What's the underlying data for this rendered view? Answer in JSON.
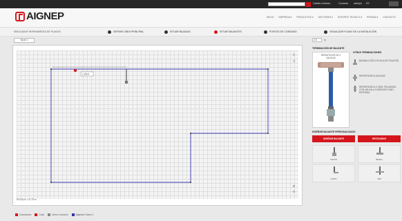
{
  "topbar": {
    "search_placeholder": "",
    "links": [
      "Calidad centrada",
      "Contactar",
      "aba/spa",
      "ES"
    ]
  },
  "header": {
    "logo_text": "AIGNEP",
    "nav": [
      "INICIO",
      "EMPRESA ▾",
      "PRODUCTOS ▾",
      "SECTORES ▾",
      "SOPORTE TÉCNICO ▾",
      "PRENSA ▾",
      "CONTACTO"
    ]
  },
  "steps_bar": {
    "title": "SIMULADOR HERRAMIENTA DE PLANOS",
    "steps": [
      {
        "label": "DEFINIR LÍNEA PRINCIPAL",
        "active": false
      },
      {
        "label": "SITUAR BAJADAS",
        "active": false
      },
      {
        "label": "SITUAR BAJANTES",
        "active": true
      },
      {
        "label": "PUNTOS DE CONSUMO",
        "active": false
      },
      {
        "label": "VISUALIZAR PLANO DE LA INSTALACIÓN",
        "active": false
      }
    ]
  },
  "tabs": [
    "Nivel 1"
  ],
  "canvas": {
    "scale_label": "ESCALA: 1:0.75 m",
    "dimension_label": "1.25 m"
  },
  "legend": [
    {
      "label": "Conexiones",
      "color": "#d4161c"
    },
    {
      "label": "Codo",
      "color": "#d4161c"
    },
    {
      "label": "Unión Conexión",
      "color": "#888888"
    },
    {
      "label": "Bajantes Tramo 1",
      "color": "#3333aa"
    }
  ],
  "right": {
    "unit_value": "2.5",
    "unit_label": "m",
    "terminal_title": "TERMINACIÓN DE BAJANTE",
    "preview_label": "REPARTIDOR DE 2 SALIDAS",
    "options_title": "OTRAS TERMINACIONES",
    "options": [
      "BAJADA CODO A PLACA DE FIJACIÓN",
      "REPARTIDOR A SALIDAS",
      "REPARTIDOR A 4 VÍAS: PULSANDO CON VÁLVULA CONEXIÓN TUBO - ENTRADA"
    ],
    "custom_title": "DISEÑAR BAJANTE PERSONALIZADO",
    "btn_design": "DISEÑAR BAJANTE",
    "btn_reset": "RESTAURAR",
    "fittings": [
      "TAPÓN",
      "BRIDA",
      "CODO",
      "TES"
    ]
  }
}
